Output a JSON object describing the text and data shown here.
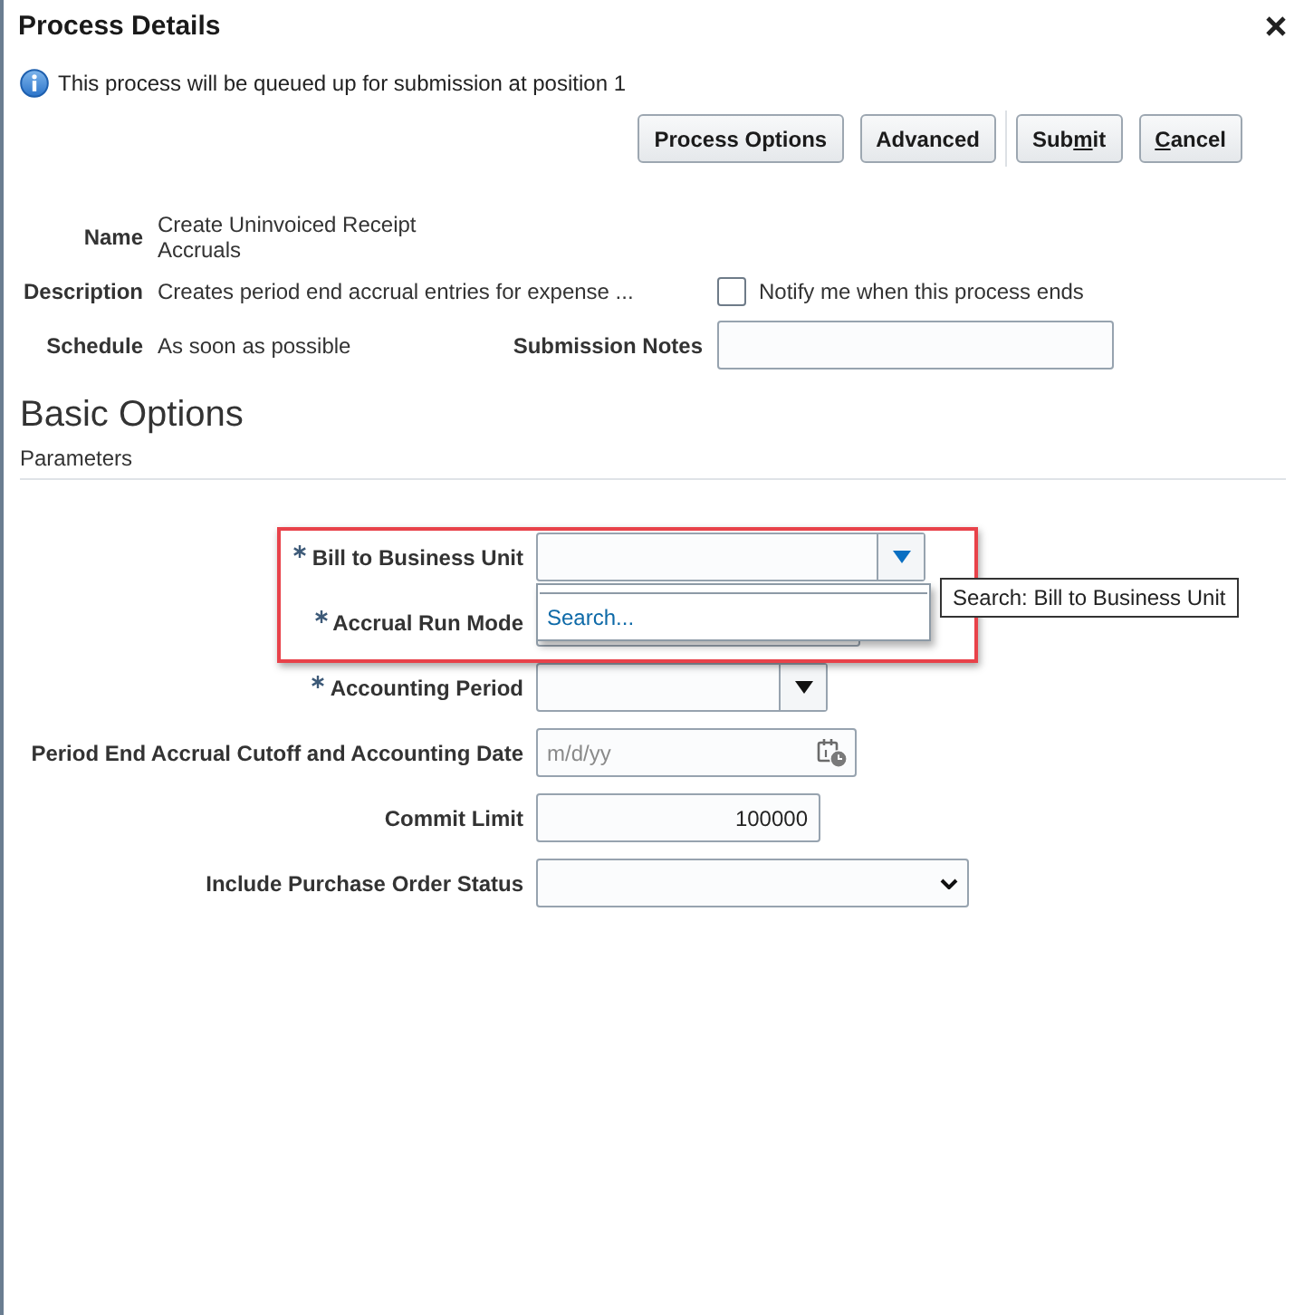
{
  "dialog": {
    "title": "Process Details"
  },
  "info_message": "This process will be queued up for submission at position 1",
  "button_groups": [
    [
      {
        "label": "Process Options"
      },
      {
        "label": "Advanced"
      }
    ],
    [
      {
        "label_start": "Sub",
        "access_key": "m",
        "label_end": "it"
      },
      {
        "access_key": "C",
        "label_end": "ancel"
      }
    ]
  ],
  "details": [
    {
      "label": "Name",
      "value": "Create Uninvoiced Receipt Accruals"
    },
    {
      "label": "Description",
      "value": "Creates period end accrual entries for expense ..."
    },
    {
      "label": "Schedule",
      "value": "As soon as possible"
    }
  ],
  "notify_checkbox": {
    "label": "Notify me when this process ends",
    "checked": false
  },
  "submission_notes": {
    "label": "Submission Notes"
  },
  "section_title": "Basic Options",
  "subsection_title": "Parameters",
  "parameters": [
    {
      "kind": "combobox",
      "label": "Bill to Business Unit",
      "required": true,
      "expanded": true,
      "highlighted": true,
      "dropdown": {
        "search_link": "Search..."
      },
      "tooltip": "Search: Bill to Business Unit"
    },
    {
      "kind": "text",
      "label": "Accrual Run Mode",
      "required": true,
      "highlighted": true
    },
    {
      "kind": "combobox",
      "label": "Accounting Period",
      "required": true,
      "expanded": false,
      "highlighted": false
    },
    {
      "kind": "date",
      "label": "Period End Accrual Cutoff and Accounting Date",
      "required": false,
      "highlighted": false,
      "placeholder": "m/d/yy"
    },
    {
      "kind": "number",
      "label": "Commit Limit",
      "required": false,
      "highlighted": false,
      "value": "100000"
    },
    {
      "kind": "select",
      "label": "Include Purchase Order Status",
      "required": false,
      "highlighted": false
    }
  ]
}
